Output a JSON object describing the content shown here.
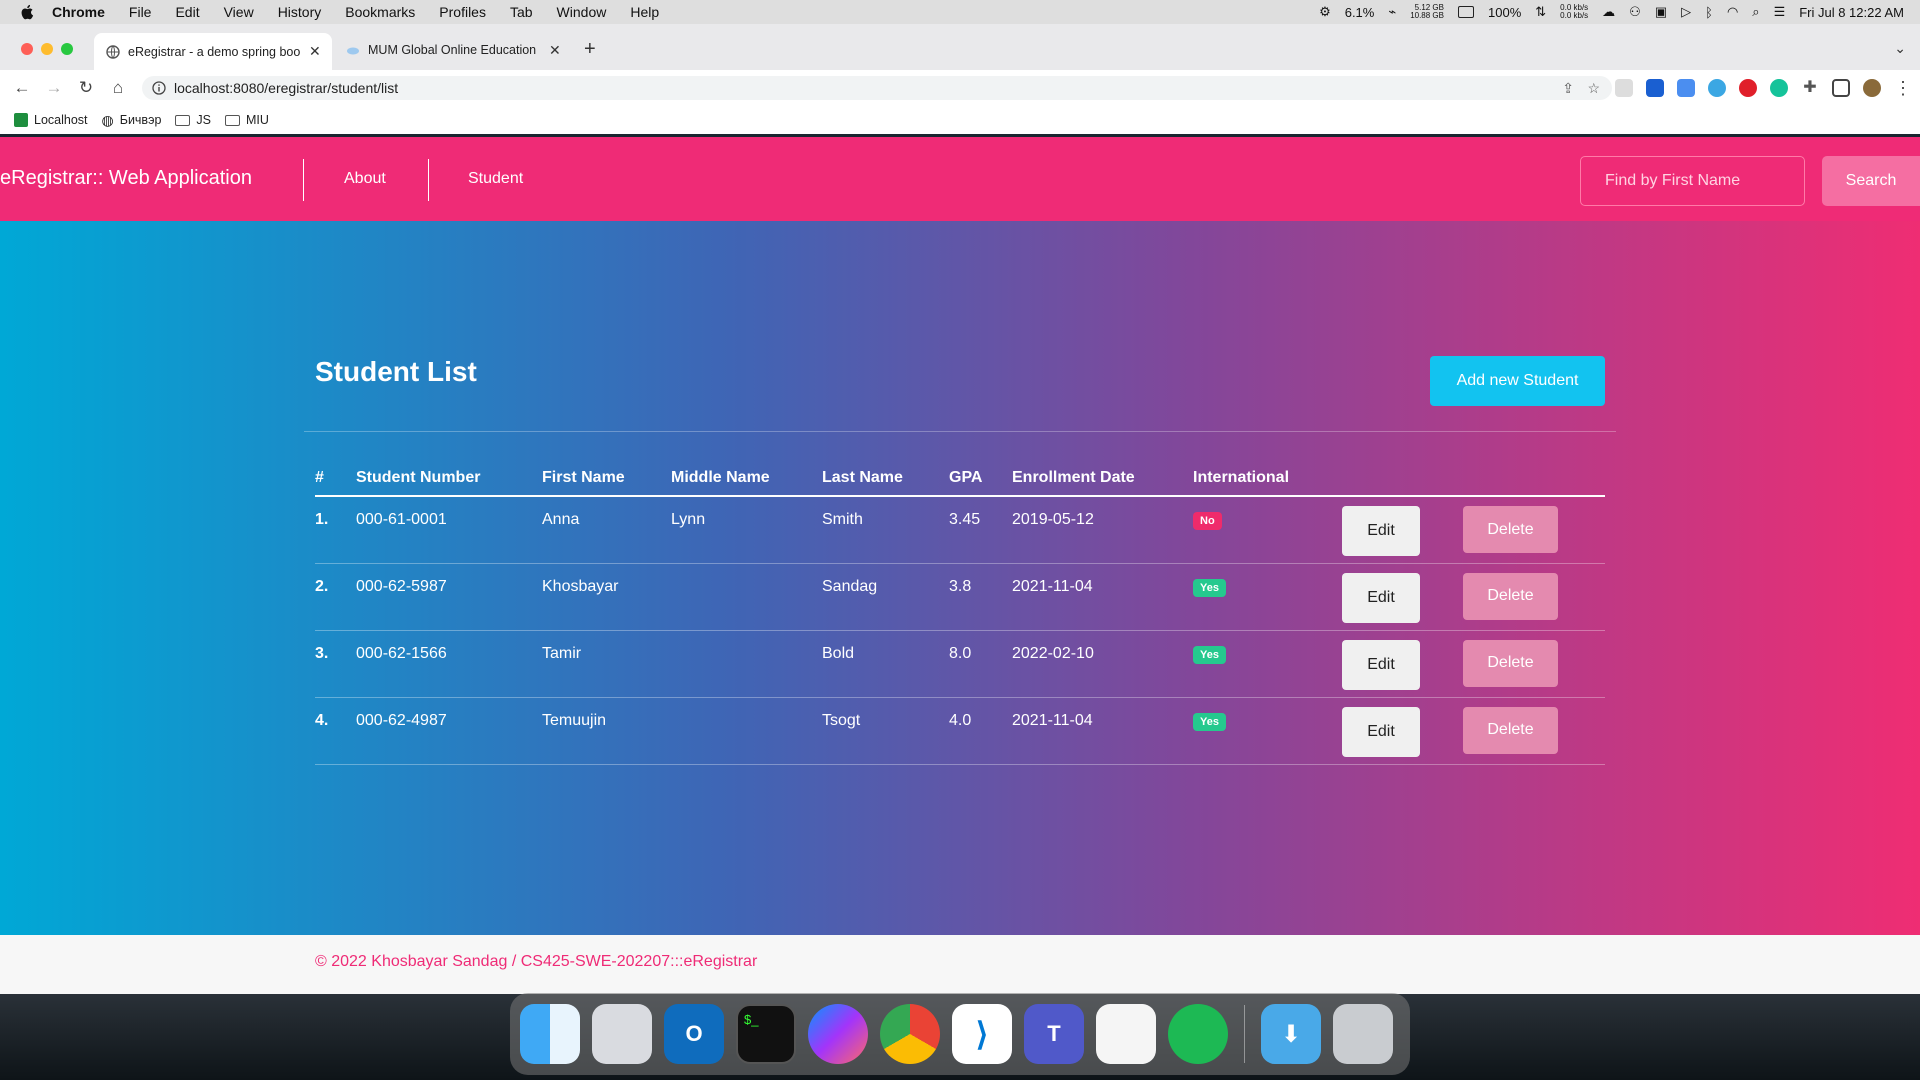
{
  "menubar": {
    "app": "Chrome",
    "items": [
      "File",
      "Edit",
      "View",
      "History",
      "Bookmarks",
      "Profiles",
      "Tab",
      "Window",
      "Help"
    ],
    "status": {
      "cpu": "6.1%",
      "mem_top": "5.12 GB",
      "mem_bottom": "10.88 GB",
      "battery": "100%",
      "net_up": "0.0 kb/s",
      "net_down": "0.0 kb/s",
      "clock": "Fri Jul 8  12:22 AM"
    }
  },
  "tabs": [
    {
      "title": "eRegistrar - a demo spring boo"
    },
    {
      "title": "MUM Global Online Education"
    }
  ],
  "address": {
    "url": "localhost:8080/eregistrar/student/list"
  },
  "bookmarks": [
    "Localhost",
    "Бичвэр",
    "JS",
    "MIU"
  ],
  "app": {
    "brand": "eRegistrar:: Web Application",
    "nav": [
      "About",
      "Student"
    ],
    "search_placeholder": "Find by First Name",
    "search_label": "Search",
    "title": "Student List",
    "add_label": "Add new Student",
    "columns": [
      "#",
      "Student Number",
      "First Name",
      "Middle Name",
      "Last Name",
      "GPA",
      "Enrollment Date",
      "International"
    ],
    "edit_label": "Edit",
    "delete_label": "Delete",
    "rows": [
      {
        "idx": "1.",
        "number": "000-61-0001",
        "first": "Anna",
        "middle": "Lynn",
        "last": "Smith",
        "gpa": "3.45",
        "date": "2019-05-12",
        "intl": "No"
      },
      {
        "idx": "2.",
        "number": "000-62-5987",
        "first": "Khosbayar",
        "middle": "",
        "last": "Sandag",
        "gpa": "3.8",
        "date": "2021-11-04",
        "intl": "Yes"
      },
      {
        "idx": "3.",
        "number": "000-62-1566",
        "first": "Tamir",
        "middle": "",
        "last": "Bold",
        "gpa": "8.0",
        "date": "2022-02-10",
        "intl": "Yes"
      },
      {
        "idx": "4.",
        "number": "000-62-4987",
        "first": "Temuujin",
        "middle": "",
        "last": "Tsogt",
        "gpa": "4.0",
        "date": "2021-11-04",
        "intl": "Yes"
      }
    ],
    "footer": "© 2022 Khosbayar Sandag / CS425-SWE-202207:::eRegistrar"
  },
  "colors": {
    "navbar": "#ef2b76",
    "add_button": "#12c3f0",
    "badge_no": "#ef2b6b",
    "badge_yes": "#25c98e"
  },
  "dock": [
    "finder-icon",
    "launchpad-icon",
    "outlook-icon",
    "terminal-icon",
    "messenger-icon",
    "chrome-icon",
    "vscode-icon",
    "teams-icon",
    "ce-icon",
    "spotify-icon",
    "downloads-icon",
    "trash-icon"
  ]
}
